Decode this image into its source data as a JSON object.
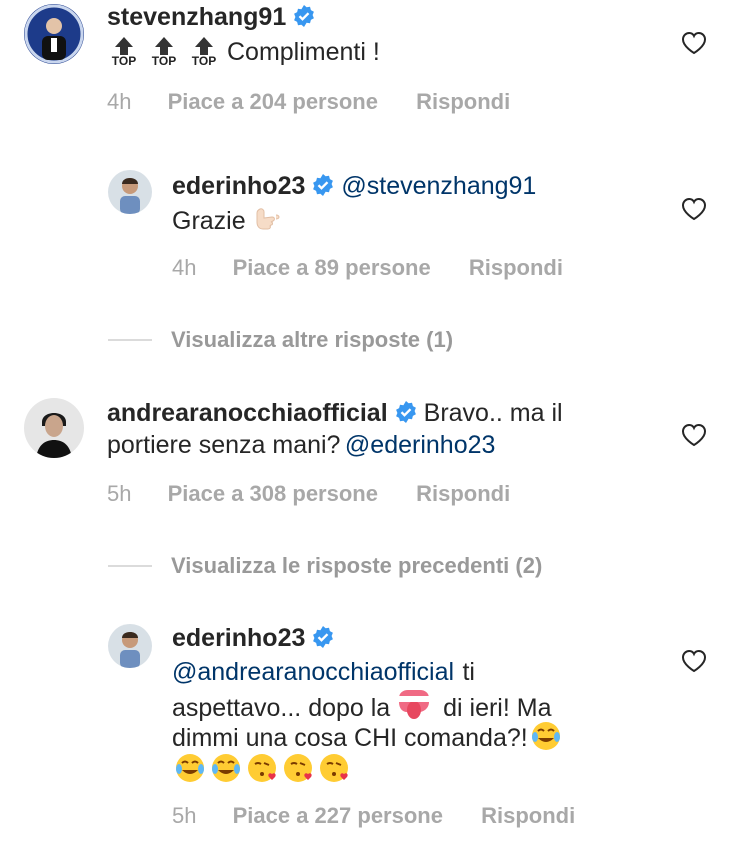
{
  "comments": [
    {
      "username": "stevenzhang91",
      "prefix_icons": [
        "top-arrow-icon",
        "top-arrow-icon",
        "top-arrow-icon"
      ],
      "top_label": "TOP",
      "text": "Complimenti !",
      "time": "4h",
      "likes": "Piace a 204 persone",
      "reply": "Rispondi"
    },
    {
      "username": "ederinho23",
      "mention": "@stevenzhang91",
      "text": "Grazie",
      "emoji": "call-me-hand-icon",
      "time": "4h",
      "likes": "Piace a 89 persone",
      "reply": "Rispondi"
    },
    {
      "more_replies": "Visualizza altre risposte (1)"
    },
    {
      "username": "andrearanocchiaofficial",
      "text_line1": "Bravo.. ma il",
      "text_line2": "portiere senza mani?",
      "mention": "@ederinho23",
      "time": "5h",
      "likes": "Piace a 308 persone",
      "reply": "Rispondi"
    },
    {
      "more_replies": "Visualizza le risposte precedenti (2)"
    },
    {
      "username": "ederinho23",
      "mention": "@andrearanocchiaofficial",
      "line1_tail": "ti",
      "line2_a": "aspettavo... dopo la",
      "line2_b": "di ieri! Ma",
      "line3": "dimmi una cosa CHI comanda?!",
      "emojis_line4": [
        "tears-of-joy-icon",
        "tears-of-joy-icon",
        "kissing-heart-icon",
        "kissing-heart-icon",
        "kissing-heart-icon"
      ],
      "time": "5h",
      "likes": "Piace a 227 persone",
      "reply": "Rispondi"
    }
  ],
  "colors": {
    "text": "#262626",
    "mention": "#003569",
    "meta": "#a8a8a8",
    "verified": "#3897f0"
  }
}
